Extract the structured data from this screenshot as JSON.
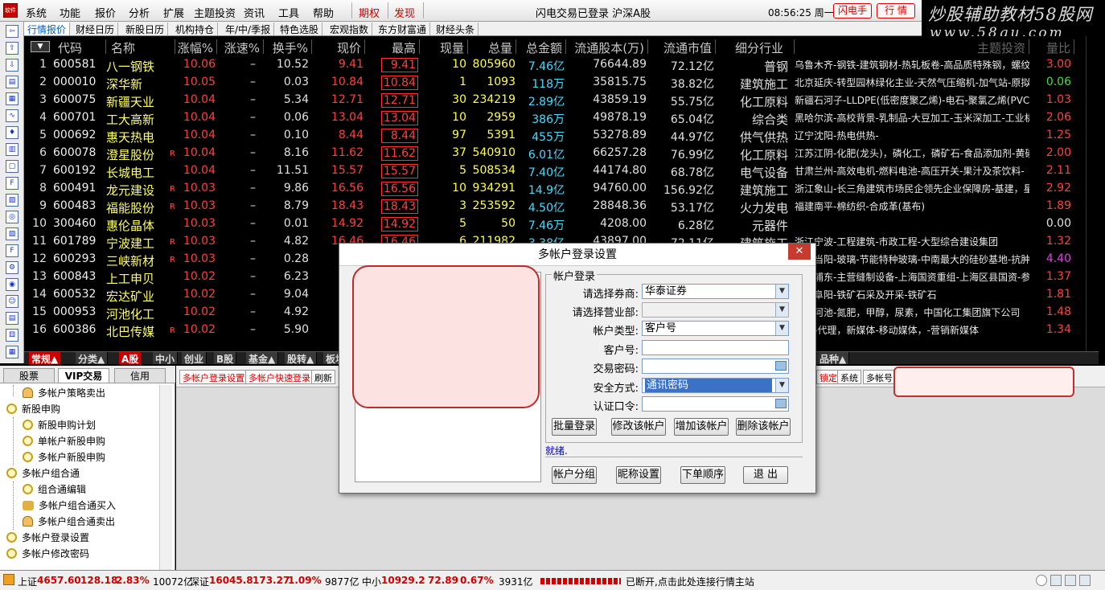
{
  "menu": [
    "系统",
    "功能",
    "报价",
    "分析",
    "扩展",
    "主题投资",
    "资讯",
    "工具",
    "帮助"
  ],
  "menu_special": [
    "期权",
    "发现"
  ],
  "app_icon": "软件",
  "status_text": "闪电交易已登录  沪深A股",
  "clock": "08:56:25 周一",
  "top_buttons": [
    "闪电手",
    "行 情"
  ],
  "watermark": {
    "line1": "炒股辅助教材58股网",
    "line2": "www.58gu.com"
  },
  "tabs": [
    "行情报价",
    "财经日历",
    "新股日历",
    "机构持仓",
    "年/中/季报",
    "特色选股",
    "宏观指数",
    "东方财富通",
    "财经头条"
  ],
  "left_toolbar_icons": [
    "back-arrow-icon",
    "up-arrow-icon",
    "down-arrow-icon",
    "news-icon",
    "table-icon",
    "line-chart-icon",
    "kline-icon",
    "report-icon",
    "doc-icon",
    "finance-icon",
    "f10-icon",
    "info-icon",
    "f10b-icon",
    "f10c-icon",
    "settings-icon",
    "target-icon",
    "people-icon",
    "chart-icon",
    "dice-icon",
    "ctrl-icon"
  ],
  "table": {
    "sort_label": "▼",
    "headers": [
      "代码",
      "名称",
      "涨幅%",
      "涨速%",
      "换手%",
      "现价",
      "最高",
      "现量",
      "总量",
      "总金额",
      "流通股本(万)",
      "流通市值",
      "细分行业",
      "主题投资",
      "量比"
    ],
    "rows": [
      {
        "idx": "1",
        "code": "600581",
        "name": "八一钢铁",
        "r": "",
        "pct": "10.06",
        "spd": "–",
        "turn": "10.52",
        "price": "9.41",
        "high": "9.41",
        "vol": "10",
        "tot": "805960",
        "amt": "7.46亿",
        "circ": "76644.89",
        "mv": "72.12亿",
        "ind": "普钢",
        "topic": "乌鲁木齐-钢铁-建筑钢材-热轧板卷-高品质特殊钢，螺纹",
        "ratio": "3.00",
        "rc": ""
      },
      {
        "idx": "2",
        "code": "000010",
        "name": "深华新",
        "r": "",
        "pct": "10.05",
        "spd": "–",
        "turn": "0.03",
        "price": "10.84",
        "high": "10.84",
        "vol": "1",
        "tot": "1093",
        "amt": "118万",
        "circ": "35815.75",
        "mv": "38.82亿",
        "ind": "建筑施工",
        "topic": "北京延庆-转型园林绿化主业-天然气压缩机-加气站-原拟",
        "ratio": "0.06",
        "rc": "g"
      },
      {
        "idx": "3",
        "code": "600075",
        "name": "新疆天业",
        "r": "",
        "pct": "10.04",
        "spd": "–",
        "turn": "5.34",
        "price": "12.71",
        "high": "12.71",
        "vol": "30",
        "tot": "234219",
        "amt": "2.89亿",
        "circ": "43859.19",
        "mv": "55.75亿",
        "ind": "化工原料",
        "topic": "新疆石河子-LLDPE(低密度聚乙烯)-电石-聚氯乙烯(PVC)-有",
        "ratio": "1.03",
        "rc": ""
      },
      {
        "idx": "4",
        "code": "600701",
        "name": "工大高新",
        "r": "",
        "pct": "10.04",
        "spd": "–",
        "turn": "0.06",
        "price": "13.04",
        "high": "13.04",
        "vol": "10",
        "tot": "2959",
        "amt": "386万",
        "circ": "49878.19",
        "mv": "65.04亿",
        "ind": "综合类",
        "topic": "黑哈尔滨-高校背景-乳制品-大豆加工-玉米深加工-工业机",
        "ratio": "2.06",
        "rc": ""
      },
      {
        "idx": "5",
        "code": "000692",
        "name": "惠天热电",
        "r": "",
        "pct": "10.04",
        "spd": "–",
        "turn": "0.10",
        "price": "8.44",
        "high": "8.44",
        "vol": "97",
        "tot": "5391",
        "amt": "455万",
        "circ": "53278.89",
        "mv": "44.97亿",
        "ind": "供气供热",
        "topic": "辽宁沈阳-热电供热-",
        "ratio": "1.25",
        "rc": ""
      },
      {
        "idx": "6",
        "code": "600078",
        "name": "澄星股份",
        "r": "R",
        "pct": "10.04",
        "spd": "–",
        "turn": "8.16",
        "price": "11.62",
        "high": "11.62",
        "vol": "37",
        "tot": "540910",
        "amt": "6.01亿",
        "circ": "66257.28",
        "mv": "76.99亿",
        "ind": "化工原料",
        "topic": "江苏江阴-化肥(龙头)，磷化工，磷矿石-食品添加剂-黄磷",
        "ratio": "2.00",
        "rc": ""
      },
      {
        "idx": "7",
        "code": "600192",
        "name": "长城电工",
        "r": "",
        "pct": "10.04",
        "spd": "–",
        "turn": "11.51",
        "price": "15.57",
        "high": "15.57",
        "vol": "5",
        "tot": "508534",
        "amt": "7.40亿",
        "circ": "44174.80",
        "mv": "68.78亿",
        "ind": "电气设备",
        "topic": "甘肃兰州-高效电机-燃料电池-高压开关-果汁及茶饮料-",
        "ratio": "2.11",
        "rc": ""
      },
      {
        "idx": "8",
        "code": "600491",
        "name": "龙元建设",
        "r": "R",
        "pct": "10.03",
        "spd": "–",
        "turn": "9.86",
        "price": "16.56",
        "high": "16.56",
        "vol": "10",
        "tot": "934291",
        "amt": "14.9亿",
        "circ": "94760.00",
        "mv": "156.92亿",
        "ind": "建筑施工",
        "topic": "浙江象山-长三角建筑市场民企领先企业保障房-基建，星",
        "ratio": "2.92",
        "rc": ""
      },
      {
        "idx": "9",
        "code": "600483",
        "name": "福能股份",
        "r": "R",
        "pct": "10.03",
        "spd": "–",
        "turn": "8.79",
        "price": "18.43",
        "high": "18.43",
        "vol": "3",
        "tot": "253592",
        "amt": "4.50亿",
        "circ": "28848.36",
        "mv": "53.17亿",
        "ind": "火力发电",
        "topic": "福建南平-棉纺织-合成革(基布)",
        "ratio": "1.89",
        "rc": ""
      },
      {
        "idx": "10",
        "code": "300460",
        "name": "惠伦晶体",
        "r": "",
        "pct": "10.03",
        "spd": "–",
        "turn": "0.01",
        "price": "14.92",
        "high": "14.92",
        "vol": "5",
        "tot": "50",
        "amt": "7.46万",
        "circ": "4208.00",
        "mv": "6.28亿",
        "ind": "元器件",
        "topic": "",
        "ratio": "0.00",
        "rc": "w"
      },
      {
        "idx": "11",
        "code": "601789",
        "name": "宁波建工",
        "r": "R",
        "pct": "10.03",
        "spd": "–",
        "turn": "4.82",
        "price": "16.46",
        "high": "16.46",
        "vol": "6",
        "tot": "211982",
        "amt": "3.38亿",
        "circ": "43897.00",
        "mv": "72.11亿",
        "ind": "建筑施工",
        "topic": "浙江宁波-工程建筑-市政工程-大型综合建设集团",
        "ratio": "1.32",
        "rc": ""
      },
      {
        "idx": "12",
        "code": "600293",
        "name": "三峡新材",
        "r": "R",
        "pct": "10.03",
        "spd": "–",
        "turn": "0.28",
        "price": "",
        "high": "",
        "vol": "",
        "tot": "",
        "amt": "",
        "circ": "",
        "mv": "",
        "ind": "",
        "topic": "湖北当阳-玻璃-节能特种玻璃-中南最大的硅砂基地-抗肿",
        "ratio": "4.40",
        "rc": "m"
      },
      {
        "idx": "13",
        "code": "600843",
        "name": "上工申贝",
        "r": "",
        "pct": "10.02",
        "spd": "–",
        "turn": "6.23",
        "price": "",
        "high": "",
        "vol": "",
        "tot": "",
        "amt": "",
        "circ": "",
        "mv": "",
        "ind": "",
        "topic": "上海浦东-主营缝制设备-上海国资重组-上海区县国资-参",
        "ratio": "1.37",
        "rc": ""
      },
      {
        "idx": "14",
        "code": "600532",
        "name": "宏达矿业",
        "r": "",
        "pct": "10.02",
        "spd": "–",
        "turn": "9.04",
        "price": "",
        "high": "",
        "vol": "",
        "tot": "",
        "amt": "",
        "circ": "",
        "mv": "",
        "ind": "",
        "topic": "辽宁阜阳-铁矿石采及开采-铁矿石",
        "ratio": "1.81",
        "rc": ""
      },
      {
        "idx": "15",
        "code": "000953",
        "name": "河池化工",
        "r": "",
        "pct": "10.02",
        "spd": "–",
        "turn": "4.92",
        "price": "",
        "high": "",
        "vol": "",
        "tot": "",
        "amt": "",
        "circ": "",
        "mv": "",
        "ind": "",
        "topic": "广西河池-氮肥，甲醇，尿素，中国化工集团旗下公司",
        "ratio": "1.48",
        "rc": ""
      },
      {
        "idx": "16",
        "code": "600386",
        "name": "北巴传媒",
        "r": "R",
        "pct": "10.02",
        "spd": "–",
        "turn": "5.90",
        "price": "",
        "high": "",
        "vol": "",
        "tot": "",
        "amt": "",
        "circ": "",
        "mv": "",
        "ind": "",
        "topic": "北京-代理，新媒体-移动媒体，-营销新媒体",
        "ratio": "1.34",
        "rc": ""
      }
    ]
  },
  "sheet_tabs": [
    "常规▲",
    "分类▲",
    "A股",
    "中小",
    "创业",
    "B股",
    "基金▲",
    "股转▲",
    "板块▲",
    "品种▲"
  ],
  "left_panel": {
    "tabs": [
      "股票",
      "VIP交易",
      "信用"
    ],
    "tree": [
      "多帐户策略卖出",
      "新股申购",
      "新股申购计划",
      "单帐户新股申购",
      "多帐户新股申购",
      "多帐户组合通",
      "组合通编辑",
      "多帐户组合通买入",
      "多帐户组合通卖出",
      "多帐户登录设置",
      "多帐户修改密码"
    ]
  },
  "content_toolbar": [
    "多帐户登录设置",
    "多帐户快速登录",
    "刷新",
    "锁定",
    "系统",
    "多帐号"
  ],
  "dialog": {
    "title": "多帐户登录设置",
    "group": "帐户登录",
    "labels": [
      "请选择券商:",
      "请选择营业部:",
      "帐户类型:",
      "客户号:",
      "交易密码:",
      "安全方式:",
      "认证口令:"
    ],
    "broker": "华泰证券",
    "dept": "",
    "account_type": "客户号",
    "client_no": "",
    "security": "通讯密码",
    "buttons_row1": [
      "批量登录",
      "修改该帐户",
      "增加该帐户",
      "删除该帐户"
    ],
    "status": "就绪.",
    "buttons_row2": [
      "帐户分组",
      "昵称设置",
      "下单顺序",
      "退 出"
    ]
  },
  "status_bar": {
    "sh_label": "上证",
    "sh_val": "4657.60",
    "sh_chg": "128.18",
    "sh_pct": "2.83%",
    "sh_amt": "10072亿",
    "sz_label": "深证",
    "sz_val": "16045.8",
    "sz_chg": "173.27",
    "sz_pct": "1.09%",
    "sz_amt": "9877亿",
    "zx_label": "中小",
    "zx_val": "10929.2",
    "zx_chg": "72.89",
    "zx_pct": "0.67%",
    "zx_amt": "3931亿",
    "msg": "已断开,点击此处连接行情主站"
  },
  "colors": {
    "up": "#ff4040",
    "accent_red": "#d00000",
    "name_yellow": "#ffff66",
    "amount_cyan": "#44ddff"
  }
}
